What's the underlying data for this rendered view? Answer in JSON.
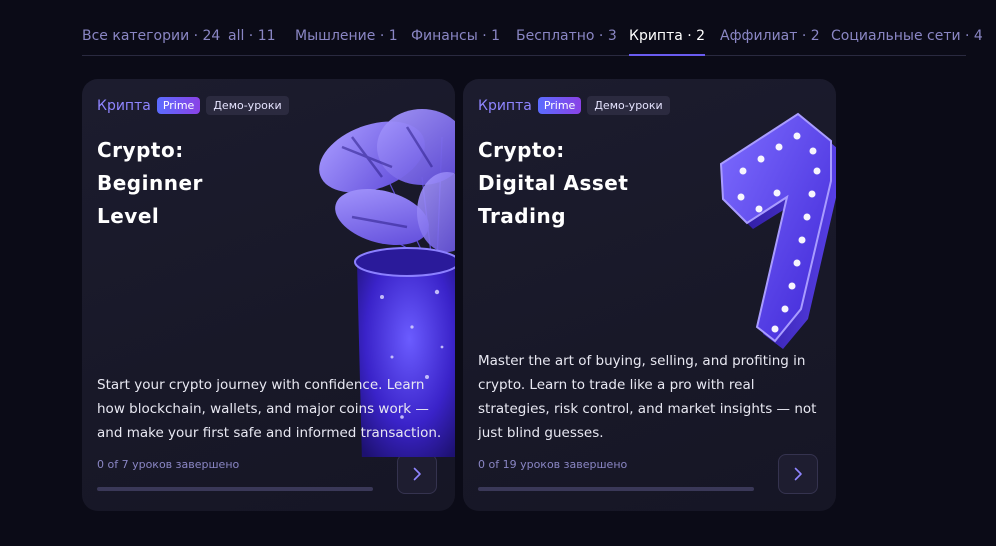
{
  "tabs": [
    {
      "label": "Все категории · 24",
      "active": false
    },
    {
      "label": "all · 11",
      "active": false
    },
    {
      "label": "Мышление · 1",
      "active": false
    },
    {
      "label": "Финансы · 1",
      "active": false
    },
    {
      "label": "Бесплатно · 3",
      "active": false
    },
    {
      "label": "Крипта · 2",
      "active": true
    },
    {
      "label": "Аффилиат · 2",
      "active": false
    },
    {
      "label": "Социальные сети · 4",
      "active": false
    }
  ],
  "cards": [
    {
      "category": "Крипта",
      "prime": "Prime",
      "demo": "Демо-уроки",
      "title_lines": [
        "Crypto:",
        "Beginner",
        "Level"
      ],
      "description": "Start your crypto journey with confidence. Learn how blockchain, wallets, and major coins work — and make your first safe and informed transaction.",
      "progress_text": "0 of 7 уроков завершено",
      "progress": 0,
      "image_icon": "monstera-plant-image"
    },
    {
      "category": "Крипта",
      "prime": "Prime",
      "demo": "Демо-уроки",
      "title_lines": [
        "Crypto:",
        "Digital Asset",
        "Trading"
      ],
      "description": "Master the art of buying, selling, and profiting in crypto. Learn to trade like a pro with real strategies, risk control, and market insights — not just blind guesses.",
      "progress_text": "0 of 19 уроков завершено",
      "progress": 0,
      "image_icon": "marquee-number-seven-image"
    }
  ],
  "colors": {
    "background": "#0b0b17",
    "card": "#1a1a2b",
    "accent": "#6a5cf0",
    "muted_text": "#8a86c4"
  }
}
